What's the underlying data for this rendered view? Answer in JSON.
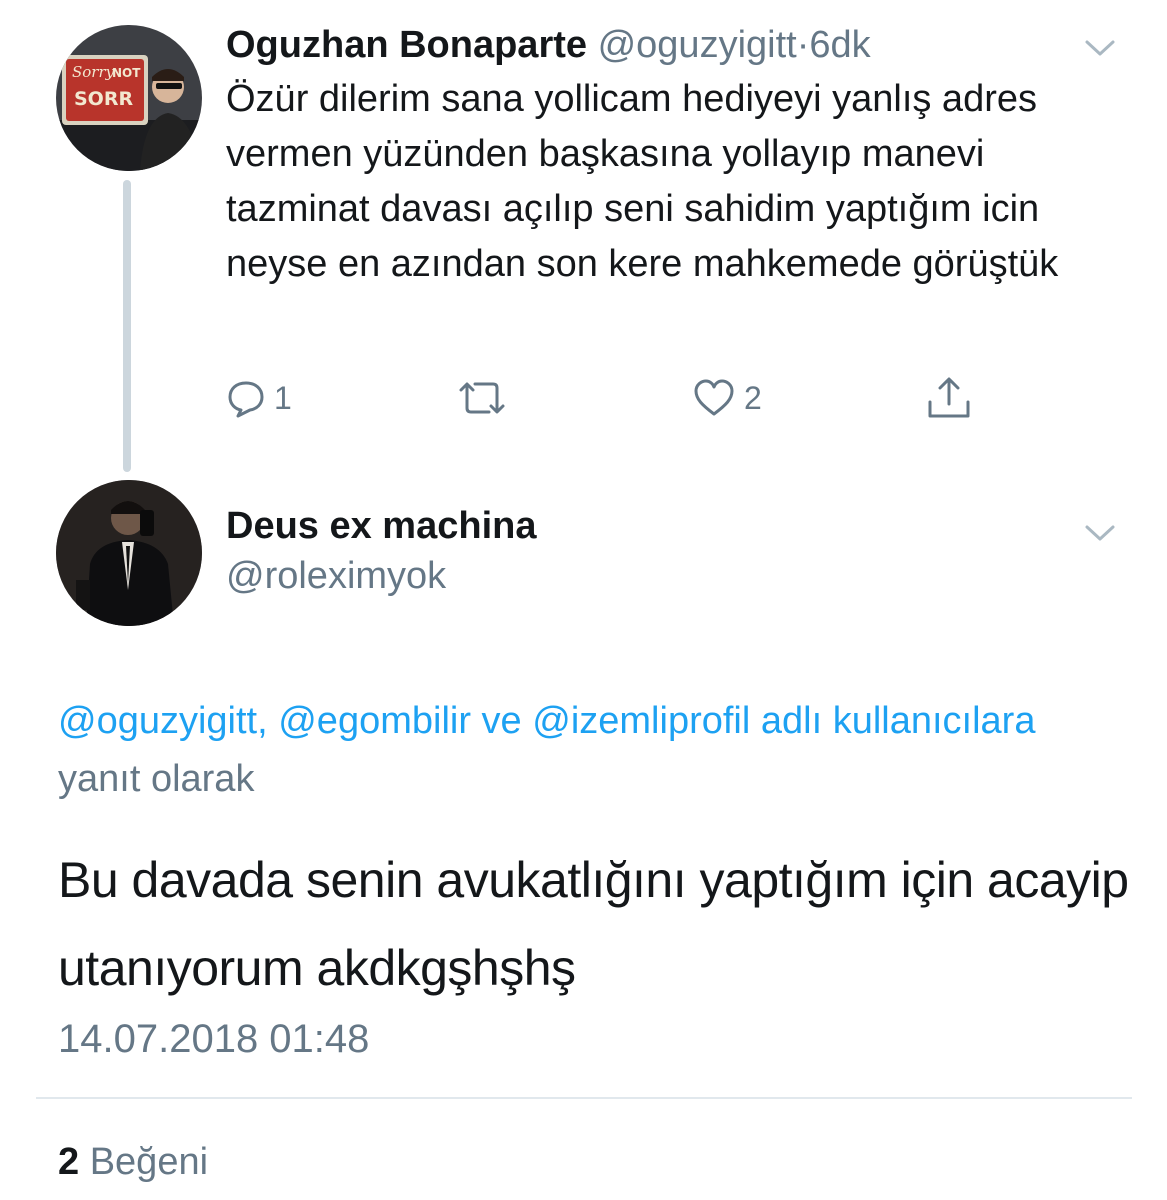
{
  "parent_tweet": {
    "avatar_sign": {
      "line1": "Sorry",
      "line2": "NOT",
      "line3": "SORR"
    },
    "display_name": "Oguzhan Bonaparte",
    "handle": "@oguzyigitt",
    "separator": "·",
    "time": "6dk",
    "text": "Özür dilerim sana yollicam hediyeyi yanlış adres vermen yüzünden başkasına yollayıp manevi tazminat davası açılıp seni sahidim yaptığım icin neyse en azından son kere mahkemede görüştük",
    "actions": {
      "reply_count": "1",
      "retweet_count": "",
      "like_count": "2"
    }
  },
  "main_tweet": {
    "display_name": "Deus ex machina",
    "handle": "@roleximyok",
    "reply_to": {
      "mention1": "@oguzyigitt,",
      "mention2": "@egombilir",
      "conjunction": "ve",
      "mention3": "@izemliprofil adlı kullanıcılara",
      "suffix": "yanıt olarak"
    },
    "text": "Bu davada senin avukatlığını yaptığım için acayip utanıyorum akdkgşhşhş",
    "timestamp": "14.07.2018 01:48",
    "likes_count": "2",
    "likes_label": "Beğeni"
  },
  "colors": {
    "text": "#14171a",
    "secondary": "#657786",
    "link": "#1da1f2",
    "thread_line": "#ccd6dd",
    "divider": "#e1e8ed"
  },
  "icons": [
    "chevron-down-icon",
    "reply-icon",
    "retweet-icon",
    "like-icon",
    "share-icon"
  ]
}
